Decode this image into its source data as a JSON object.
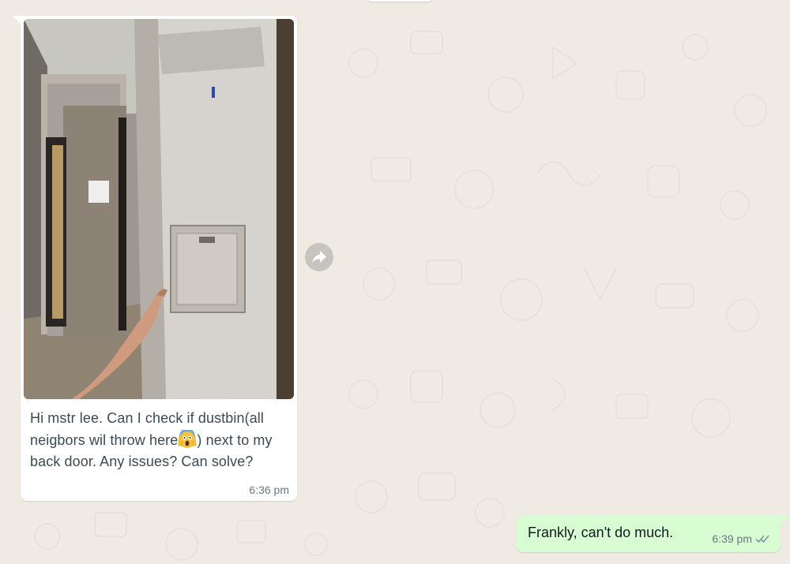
{
  "chat": {
    "incoming": {
      "caption_part1": "Hi mstr lee. Can I check if dustbin(all neigbors wil throw here",
      "caption_emoji": "face-screaming-in-fear",
      "caption_part2": ") next to my back door. Any issues? Can solve?",
      "time": "6:36 pm",
      "image_description_icon": "photo"
    },
    "outgoing": {
      "text": "Frankly, can't do much.",
      "time": "6:39 pm",
      "status_icon": "double-check-read"
    },
    "forward_icon": "forward-arrow-icon"
  },
  "colors": {
    "background": "#efeae2",
    "incoming_bubble": "#ffffff",
    "outgoing_bubble": "#d9fdd3",
    "meta_text": "#667781",
    "message_text": "#3b4a54"
  }
}
